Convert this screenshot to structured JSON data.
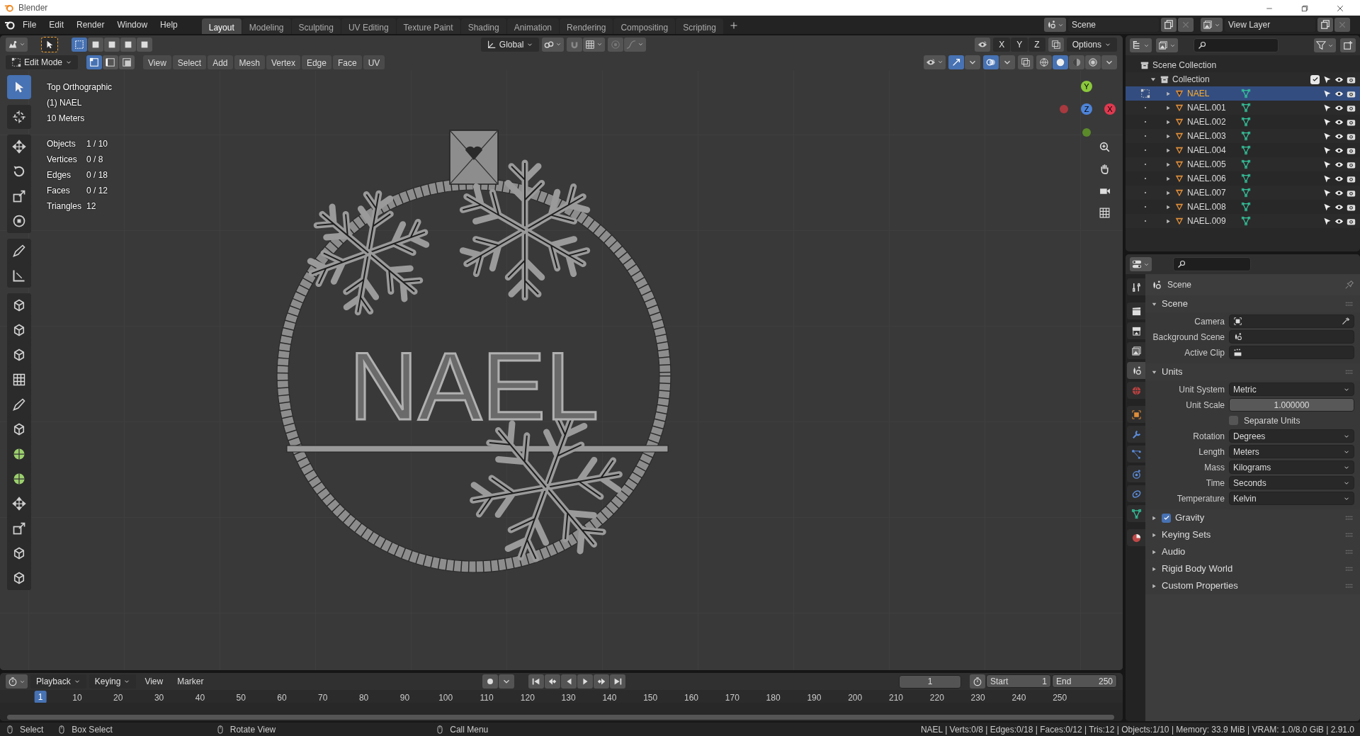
{
  "window": {
    "title": "Blender"
  },
  "menu_bar": {
    "menus": [
      "File",
      "Edit",
      "Render",
      "Window",
      "Help"
    ],
    "workspace_tabs": [
      {
        "label": "Layout",
        "selected": true
      },
      {
        "label": "Modeling",
        "selected": false
      },
      {
        "label": "Sculpting",
        "selected": false
      },
      {
        "label": "UV Editing",
        "selected": false
      },
      {
        "label": "Texture Paint",
        "selected": false
      },
      {
        "label": "Shading",
        "selected": false
      },
      {
        "label": "Animation",
        "selected": false
      },
      {
        "label": "Rendering",
        "selected": false
      },
      {
        "label": "Compositing",
        "selected": false
      },
      {
        "label": "Scripting",
        "selected": false
      }
    ],
    "scene": "Scene",
    "view_layer": "View Layer"
  },
  "viewport": {
    "header": {
      "selection_modes": [
        {
          "selected": true
        },
        {
          "selected": false
        },
        {
          "selected": false
        },
        {
          "selected": false
        },
        {
          "selected": false
        }
      ],
      "transform_orientation": "Global",
      "axes": [
        "X",
        "Y",
        "Z"
      ],
      "options": "Options",
      "mode": "Edit Mode",
      "element_modes": [
        {
          "selected": true
        },
        {
          "selected": false
        },
        {
          "selected": false
        }
      ],
      "menus": [
        "View",
        "Select",
        "Add",
        "Mesh",
        "Vertex",
        "Edge",
        "Face",
        "UV"
      ],
      "gizmos_on": true,
      "overlays_on": true,
      "xray_on": false,
      "shading_modes": [
        {
          "selected": false
        },
        {
          "selected": true
        },
        {
          "selected": false
        },
        {
          "selected": false
        }
      ]
    },
    "tool_groups": [
      [
        {
          "selected": true
        }
      ],
      [
        {
          "selected": false
        }
      ],
      [
        {
          "selected": false
        },
        {
          "selected": false
        },
        {
          "selected": false
        },
        {
          "selected": false
        }
      ],
      [
        {
          "selected": false
        },
        {
          "selected": false
        }
      ],
      [
        {
          "selected": false
        },
        {
          "selected": false
        },
        {
          "selected": false
        },
        {
          "selected": false
        },
        {
          "selected": false
        },
        {
          "selected": false
        },
        {
          "selected": false
        },
        {
          "selected": false
        },
        {
          "selected": false
        },
        {
          "selected": false
        },
        {
          "selected": false
        },
        {
          "selected": false
        }
      ]
    ],
    "overlay": {
      "view": "Top Orthographic",
      "object": "(1) NAEL",
      "scale": "10 Meters",
      "stats": [
        {
          "label": "Objects",
          "value": "1 / 10"
        },
        {
          "label": "Vertices",
          "value": "0 / 8"
        },
        {
          "label": "Edges",
          "value": "0 / 18"
        },
        {
          "label": "Faces",
          "value": "0 / 12"
        },
        {
          "label": "Triangles",
          "value": "12"
        }
      ]
    },
    "model_text": "NAEL",
    "gizmo_axes": [
      "Y",
      "Z",
      "X"
    ]
  },
  "outliner": {
    "root": "Scene Collection",
    "collections": [
      {
        "name": "Collection",
        "expanded": true,
        "checked": true,
        "children": [
          {
            "name": "NAEL",
            "selected": true,
            "expanded": false
          },
          {
            "name": "NAEL.001",
            "selected": false,
            "expanded": false
          },
          {
            "name": "NAEL.002",
            "selected": false,
            "expanded": false
          },
          {
            "name": "NAEL.003",
            "selected": false,
            "expanded": false
          },
          {
            "name": "NAEL.004",
            "selected": false,
            "expanded": false
          },
          {
            "name": "NAEL.005",
            "selected": false,
            "expanded": false
          },
          {
            "name": "NAEL.006",
            "selected": false,
            "expanded": false
          },
          {
            "name": "NAEL.007",
            "selected": false,
            "expanded": false
          },
          {
            "name": "NAEL.008",
            "selected": false,
            "expanded": false
          },
          {
            "name": "NAEL.009",
            "selected": false,
            "expanded": false
          }
        ]
      }
    ]
  },
  "properties": {
    "tabs": [
      {
        "selected": false
      },
      {
        "selected": false
      },
      {
        "selected": false
      },
      {
        "selected": false
      },
      {
        "selected": true
      },
      {
        "selected": false
      },
      {
        "selected": false
      },
      {
        "selected": false
      },
      {
        "selected": false
      },
      {
        "selected": false
      },
      {
        "selected": false
      },
      {
        "selected": false
      },
      {
        "selected": false
      }
    ],
    "context": "Scene",
    "panels": [
      {
        "kind": "section",
        "title": "Scene",
        "expanded": true,
        "fields": [
          {
            "kind": "object",
            "label": "Camera"
          },
          {
            "kind": "object",
            "label": "Background Scene"
          },
          {
            "kind": "object",
            "label": "Active Clip"
          }
        ]
      },
      {
        "kind": "section",
        "title": "Units",
        "expanded": true,
        "fields": [
          {
            "kind": "dropdown",
            "label": "Unit System",
            "value": "Metric"
          },
          {
            "kind": "number",
            "label": "Unit Scale",
            "value": "1.000000"
          },
          {
            "kind": "checkbox",
            "label": "Separate Units",
            "checked": false
          },
          {
            "kind": "dropdown",
            "label": "Rotation",
            "value": "Degrees"
          },
          {
            "kind": "dropdown",
            "label": "Length",
            "value": "Meters"
          },
          {
            "kind": "dropdown",
            "label": "Mass",
            "value": "Kilograms"
          },
          {
            "kind": "dropdown",
            "label": "Time",
            "value": "Seconds"
          },
          {
            "kind": "dropdown",
            "label": "Temperature",
            "value": "Kelvin"
          }
        ]
      },
      {
        "kind": "toggle_section",
        "title": "Gravity",
        "expanded": false,
        "checked": true
      },
      {
        "kind": "section",
        "title": "Keying Sets",
        "expanded": false
      },
      {
        "kind": "section",
        "title": "Audio",
        "expanded": false
      },
      {
        "kind": "section",
        "title": "Rigid Body World",
        "expanded": false
      },
      {
        "kind": "section",
        "title": "Custom Properties",
        "expanded": false
      }
    ]
  },
  "timeline": {
    "menus": [
      "Playback",
      "Keying",
      "View",
      "Marker"
    ],
    "current_frame": "1",
    "start_label": "Start",
    "start": "1",
    "end_label": "End",
    "end": "250",
    "playhead": "1",
    "ruler": [
      "10",
      "20",
      "30",
      "40",
      "50",
      "60",
      "70",
      "80",
      "90",
      "100",
      "110",
      "120",
      "130",
      "140",
      "150",
      "160",
      "170",
      "180",
      "190",
      "200",
      "210",
      "220",
      "230",
      "240",
      "250"
    ]
  },
  "status_bar": {
    "hints": [
      "Select",
      "Box Select",
      "Rotate View",
      "Call Menu"
    ],
    "stats": "NAEL | Verts:0/8 | Edges:0/18 | Faces:0/12 | Tris:12 | Objects:1/10 | Memory: 33.9 MiB | VRAM: 1.0/8.0 GiB | 2.91.0"
  }
}
